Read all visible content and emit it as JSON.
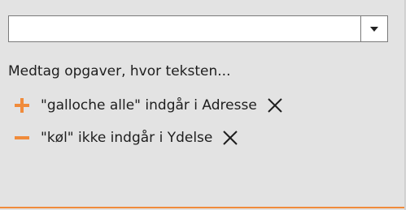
{
  "filter_panel": {
    "dropdown": {
      "selected_value": ""
    },
    "hint_text": "Medtag opgaver, hvor teksten...",
    "filters": [
      {
        "operator": "include",
        "operator_icon": "plus-icon",
        "text": "\"galloche alle\" indgår i Adresse"
      },
      {
        "operator": "exclude",
        "operator_icon": "minus-icon",
        "text": "\"køl\" ikke indgår i Ydelse"
      }
    ],
    "colors": {
      "accent": "#f08b3b",
      "panel_background": "#e3e3e3"
    }
  }
}
